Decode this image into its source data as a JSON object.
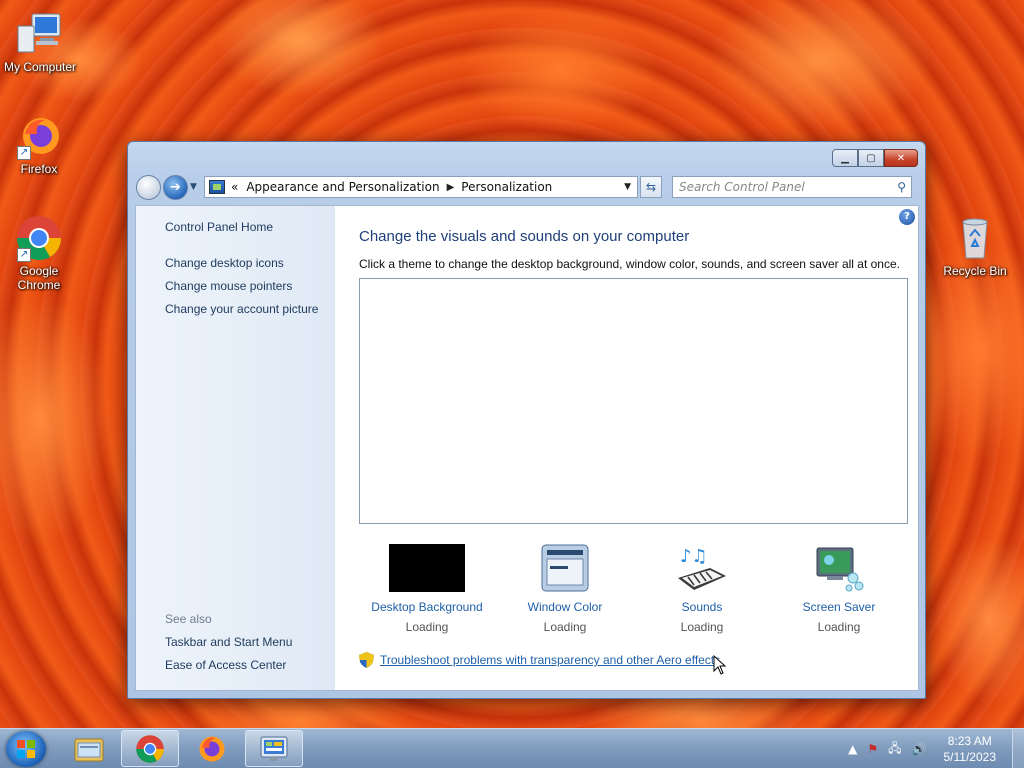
{
  "desktop": {
    "icons": [
      {
        "label": "My Computer",
        "icon": "computer-icon"
      },
      {
        "label": "Firefox",
        "icon": "firefox-icon"
      },
      {
        "label": "Google Chrome",
        "icon": "chrome-icon"
      },
      {
        "label": "Recycle Bin",
        "icon": "recycle-bin-icon"
      }
    ]
  },
  "window": {
    "breadcrumb": [
      "Appearance and Personalization",
      "Personalization"
    ],
    "breadcrumb_prefix": "«",
    "search_placeholder": "Search Control Panel",
    "title_buttons": {
      "minimize": "minimize-icon",
      "maximize": "maximize-icon",
      "close": "close-icon"
    }
  },
  "sidebar": {
    "home": "Control Panel Home",
    "links": [
      "Change desktop icons",
      "Change mouse pointers",
      "Change your account picture"
    ],
    "see_also_label": "See also",
    "see_also": [
      "Taskbar and Start Menu",
      "Ease of Access Center"
    ]
  },
  "main": {
    "heading": "Change the visuals and sounds on your computer",
    "subtext": "Click a theme to change the desktop background, window color, sounds, and screen saver all at once.",
    "tiles": [
      {
        "label": "Desktop Background",
        "status": "Loading",
        "icon": "desktop-background-icon"
      },
      {
        "label": "Window Color",
        "status": "Loading",
        "icon": "window-color-icon"
      },
      {
        "label": "Sounds",
        "status": "Loading",
        "icon": "sounds-icon"
      },
      {
        "label": "Screen Saver",
        "status": "Loading",
        "icon": "screen-saver-icon"
      }
    ],
    "troubleshoot": "Troubleshoot problems with transparency and other Aero effects"
  },
  "taskbar": {
    "items": [
      "file-explorer-icon",
      "chrome-icon",
      "firefox-icon",
      "control-panel-icon"
    ],
    "active_item": "chrome-icon",
    "time": "8:23 AM",
    "date": "5/11/2023"
  },
  "colors": {
    "link": "#1e5fa8",
    "heading": "#1e3f78",
    "close_button": "#c7432a",
    "taskbar": "#7f9bbd"
  }
}
